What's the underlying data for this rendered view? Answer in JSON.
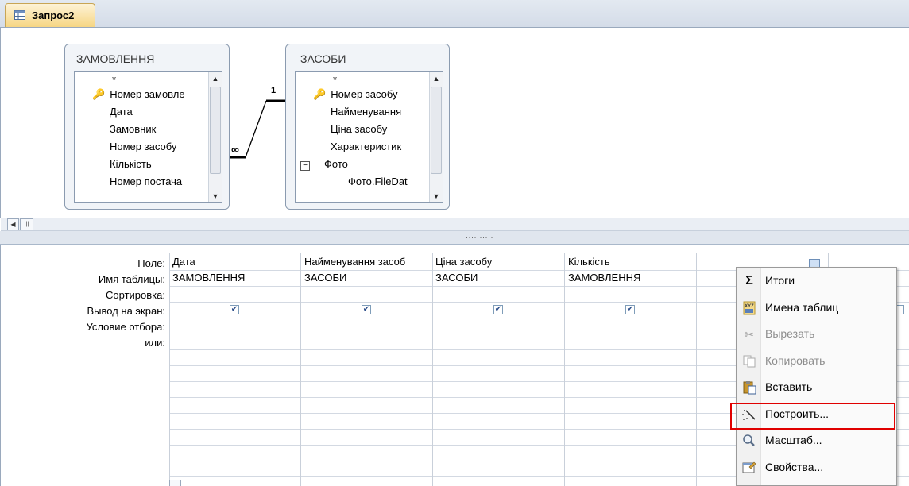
{
  "window": {
    "tab_title": "Запрос2"
  },
  "tables": [
    {
      "title": "ЗАМОВЛЕННЯ",
      "fields": [
        "*",
        "Номер замовле",
        "Дата",
        "Замовник",
        "Номер засобу",
        "Кількість",
        "Номер постача"
      ],
      "key_field_index": 1
    },
    {
      "title": "ЗАСОБИ",
      "fields": [
        "*",
        "Номер засобу",
        "Найменування",
        "Ціна засобу",
        "Характеристик",
        "Фото",
        "Фото.FileDat"
      ],
      "key_field_index": 1
    }
  ],
  "relationship": {
    "one_label": "1",
    "many_label": "∞"
  },
  "grid": {
    "row_labels": [
      "Поле:",
      "Имя таблицы:",
      "Сортировка:",
      "Вывод на экран:",
      "Условие отбора:",
      "или:"
    ],
    "columns": [
      {
        "field": "Дата",
        "table": "ЗАМОВЛЕННЯ",
        "show": true
      },
      {
        "field": "Найменування засоб",
        "table": "ЗАСОБИ",
        "show": true
      },
      {
        "field": "Ціна засобу",
        "table": "ЗАСОБИ",
        "show": true
      },
      {
        "field": "Кількість",
        "table": "ЗАМОВЛЕННЯ",
        "show": true
      }
    ]
  },
  "context_menu": {
    "items": [
      {
        "label": "Итоги",
        "icon": "sigma-icon",
        "disabled": false
      },
      {
        "label": "Имена таблиц",
        "icon": "table-names-icon",
        "disabled": false
      },
      {
        "label": "Вырезать",
        "icon": "scissors-icon",
        "disabled": true
      },
      {
        "label": "Копировать",
        "icon": "copy-icon",
        "disabled": true
      },
      {
        "label": "Вставить",
        "icon": "paste-icon",
        "disabled": false
      },
      {
        "label": "Построить...",
        "icon": "build-wand-icon",
        "disabled": false,
        "highlighted": true
      },
      {
        "label": "Масштаб...",
        "icon": "zoom-icon",
        "disabled": false
      },
      {
        "label": "Свойства...",
        "icon": "properties-icon",
        "disabled": false
      }
    ]
  },
  "colors": {
    "highlight_border": "#e00000",
    "tab_active": "#f6d683"
  }
}
